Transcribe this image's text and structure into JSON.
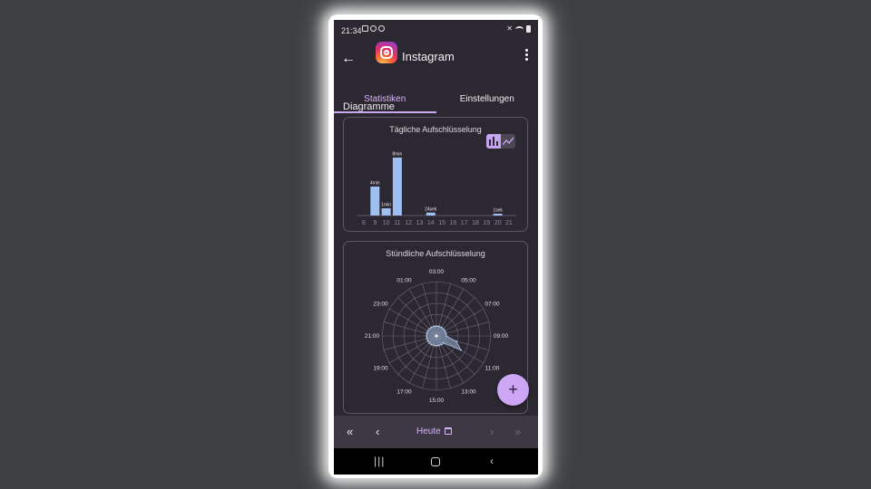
{
  "status_bar": {
    "time": "21:34"
  },
  "app_bar": {
    "title": "Instagram",
    "back_icon": "arrow-left-icon",
    "menu_icon": "more-vert-icon"
  },
  "tabs": [
    {
      "label": "Statistiken",
      "active": true
    },
    {
      "label": "Einstellungen",
      "active": false
    }
  ],
  "section": {
    "title": "Diagramme"
  },
  "daily_card": {
    "title": "Tägliche Aufschlüsselung",
    "toggle": [
      "bar-chart-icon",
      "line-chart-icon"
    ]
  },
  "hourly_card": {
    "title": "Stündliche Aufschlüsselung"
  },
  "fab": {
    "label": "+"
  },
  "bottom_nav": {
    "today_label": "Heute"
  },
  "colors": {
    "accent": "#cca6f4",
    "bar": "#9fbff2",
    "background": "#2c2831"
  },
  "chart_data": [
    {
      "type": "bar",
      "title": "Tägliche Aufschlüsselung",
      "categories": [
        "8",
        "9",
        "10",
        "11",
        "12",
        "13",
        "14",
        "15",
        "16",
        "17",
        "18",
        "19",
        "20",
        "21"
      ],
      "values": [
        0,
        4,
        1,
        8,
        0,
        0,
        0.4,
        0,
        0,
        0,
        0,
        0,
        0.0167,
        0
      ],
      "value_unit": "min",
      "data_labels": [
        "",
        "4min",
        "1min",
        "8min",
        "",
        "",
        "24sek",
        "",
        "",
        "",
        "",
        "",
        "1sek",
        ""
      ],
      "ylim": [
        0,
        8
      ]
    },
    {
      "type": "radar",
      "title": "Stündliche Aufschlüsselung",
      "tick_labels": [
        "03:00",
        "05:00",
        "07:00",
        "09:00",
        "11:00",
        "13:00",
        "15:00",
        "17:00",
        "19:00",
        "21:00",
        "23:00",
        "01:00"
      ],
      "categories": [
        "00",
        "01",
        "02",
        "03",
        "04",
        "05",
        "06",
        "07",
        "08",
        "09",
        "10",
        "11",
        "12",
        "13",
        "14",
        "15",
        "16",
        "17",
        "18",
        "19",
        "20",
        "21",
        "22",
        "23"
      ],
      "values": [
        0.18,
        0.18,
        0.18,
        0.18,
        0.18,
        0.18,
        0.18,
        0.18,
        0.18,
        0.18,
        0.38,
        0.52,
        0.18,
        0.18,
        0.18,
        0.18,
        0.18,
        0.18,
        0.18,
        0.18,
        0.18,
        0.18,
        0.18,
        0.18
      ]
    }
  ]
}
